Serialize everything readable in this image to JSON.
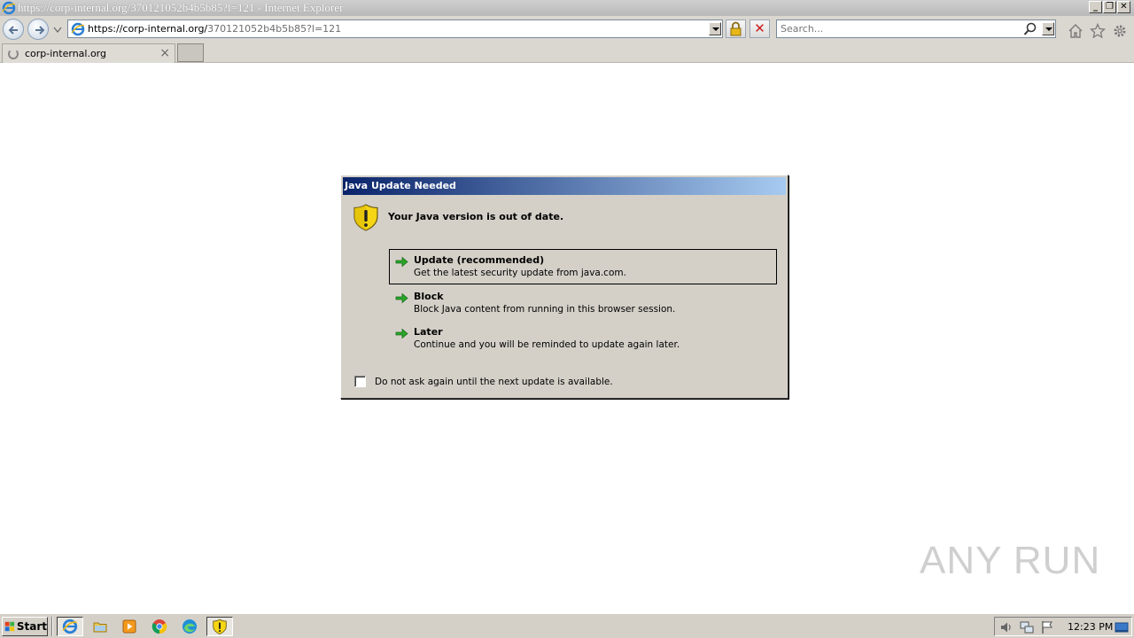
{
  "window": {
    "title": "https://corp-internal.org/370121052b4b5b85?l=121 - Internet Explorer",
    "controls": [
      "_",
      "❐",
      "✕"
    ]
  },
  "address_bar": {
    "url_host": "https://corp-internal.org/",
    "url_path": "370121052b4b5b85?l=121"
  },
  "search": {
    "placeholder": "Search..."
  },
  "tabs": [
    {
      "label": "corp-internal.org",
      "close": "×"
    }
  ],
  "dialog": {
    "title": "Java Update Needed",
    "heading": "Your Java version is out of date.",
    "options": [
      {
        "title": "Update (recommended)",
        "desc": "Get the latest security update from java.com."
      },
      {
        "title": "Block",
        "desc": "Block Java content from running in this browser session."
      },
      {
        "title": "Later",
        "desc": "Continue and you will be reminded to update again later."
      }
    ],
    "checkbox_label": "Do not ask again until the next update is available."
  },
  "watermark": {
    "text": "ANY RUN"
  },
  "taskbar": {
    "start_label": "Start",
    "clock": "12:23 PM"
  },
  "colors": {
    "dialog_bg": "#d4d0c8",
    "title_gradient_start": "#0a246a",
    "title_gradient_end": "#a6caf0",
    "arrow_green": "#2aa52a",
    "shield_yellow": "#f5d514"
  }
}
